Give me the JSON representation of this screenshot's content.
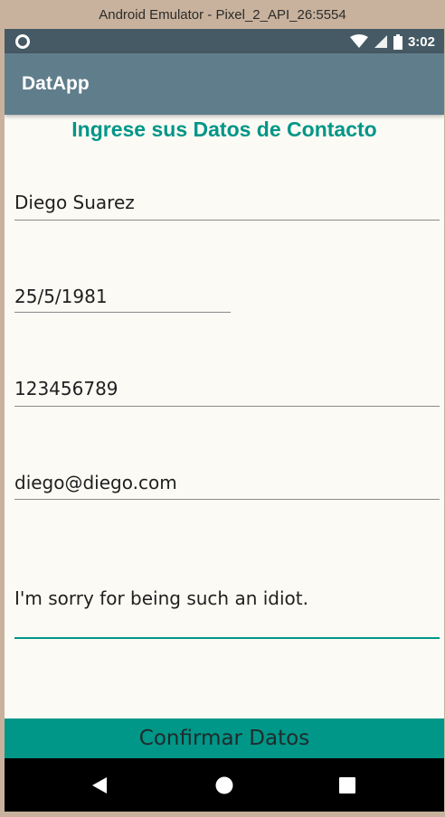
{
  "window": {
    "title": "Android Emulator - Pixel_2_API_26:5554"
  },
  "status_bar": {
    "time": "3:02",
    "icons": [
      "record-icon",
      "wifi-icon",
      "signal-icon",
      "battery-icon"
    ]
  },
  "app_bar": {
    "title": "DatApp"
  },
  "form": {
    "title": "Ingrese sus Datos de Contacto",
    "fields": [
      {
        "name": "name",
        "value": "Diego Suarez"
      },
      {
        "name": "birthdate",
        "value": "25/5/1981"
      },
      {
        "name": "phone",
        "value": "123456789"
      },
      {
        "name": "email",
        "value": "diego@diego.com"
      },
      {
        "name": "description",
        "value": "I'm sorry for being such an idiot."
      }
    ],
    "confirm_label": "Confirmar Datos"
  },
  "nav_bar": {
    "buttons": [
      "back-icon",
      "home-icon",
      "recents-icon"
    ]
  },
  "colors": {
    "accent": "#009688",
    "app_bar": "#607d8b",
    "status_bar": "#455a64",
    "background": "#fcfaf4"
  }
}
